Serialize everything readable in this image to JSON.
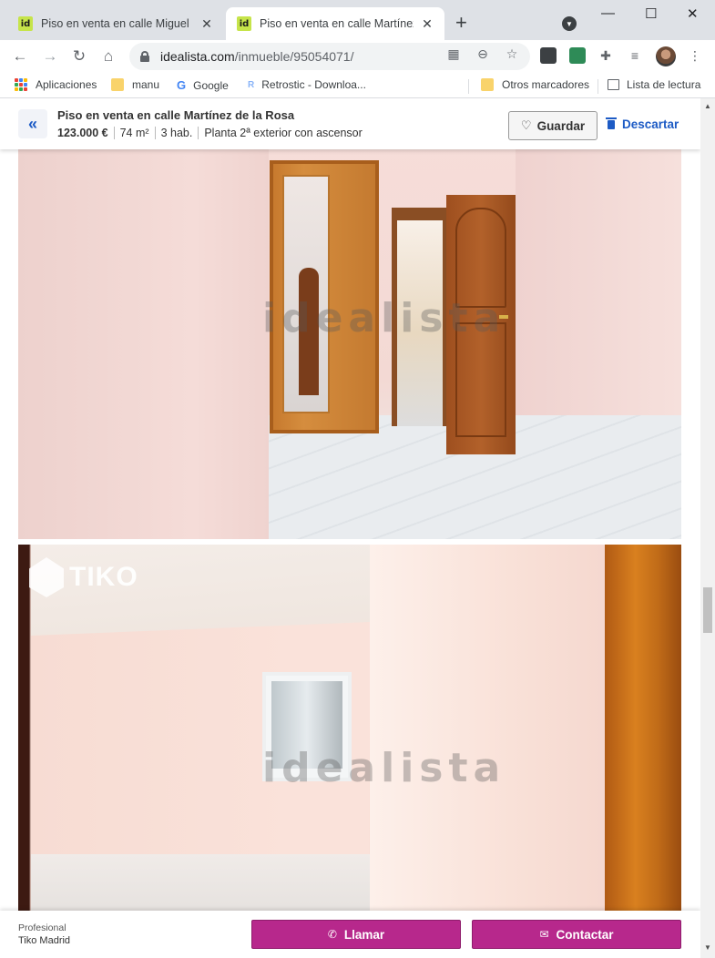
{
  "browser": {
    "tabs": [
      {
        "title": "Piso en venta en calle Miguel Moya",
        "favicon": "id",
        "active": false
      },
      {
        "title": "Piso en venta en calle Martínez de la Rosa",
        "favicon": "id",
        "active": true
      }
    ],
    "new_tab": "+",
    "window_controls": {
      "minimize": "—",
      "maximize": "☐",
      "close": "✕"
    },
    "url_host": "idealista.com",
    "url_path": "/inmueble/95054071/",
    "bookmarks": [
      {
        "label": "Aplicaciones",
        "icon": "apps-grid-icon"
      },
      {
        "label": "manu",
        "icon": "folder-icon"
      },
      {
        "label": "Google",
        "icon": "google-icon"
      },
      {
        "label": "Retrostic - Downloa...",
        "icon": "retrostic-icon"
      },
      {
        "label": "Otros marcadores",
        "icon": "folder-icon"
      },
      {
        "label": "Lista de lectura",
        "icon": "reading-list-icon"
      }
    ]
  },
  "listing": {
    "back": "«",
    "title": "Piso en venta en calle Martínez de la Rosa",
    "price": "123.000 €",
    "area": "74 m²",
    "rooms": "3 hab.",
    "floor": "Planta 2ª exterior con ascensor",
    "save_label": "Guardar",
    "discard_label": "Descartar"
  },
  "photos": {
    "watermark": "idealista",
    "brand": "TIKO"
  },
  "contact": {
    "pro_label": "Profesional",
    "agency": "Tiko Madrid",
    "call_label": "Llamar",
    "contact_label": "Contactar"
  },
  "colors": {
    "accent_blue": "#1d5bc5",
    "contact_magenta": "#b7288c"
  }
}
